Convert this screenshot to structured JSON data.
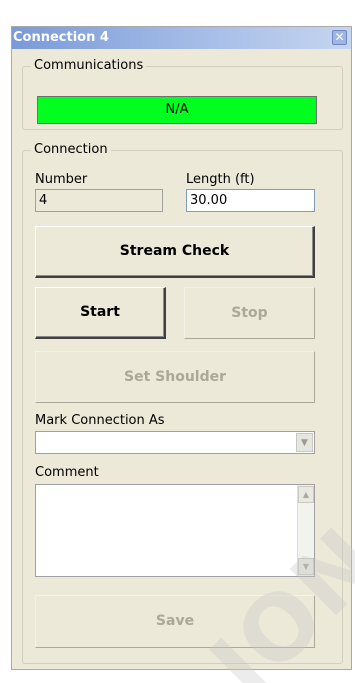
{
  "window": {
    "title": "Connection 4",
    "close_glyph": "✕"
  },
  "communications": {
    "group_label": "Communications",
    "status_text": "N/A",
    "status_color": "#00ff1e"
  },
  "connection": {
    "group_label": "Connection",
    "number_label": "Number",
    "number_value": "4",
    "length_label": "Length (ft)",
    "length_value": "30.00",
    "stream_check_label": "Stream Check",
    "start_label": "Start",
    "stop_label": "Stop",
    "set_shoulder_label": "Set Shoulder",
    "mark_as_label": "Mark Connection As",
    "mark_as_value": "",
    "comment_label": "Comment",
    "comment_value": "",
    "save_label": "Save"
  },
  "watermark": {
    "text": "ION"
  },
  "colors": {
    "window_bg": "#ece9d8",
    "titlebar": "#7a9ad8",
    "disabled_text": "#aca899"
  }
}
